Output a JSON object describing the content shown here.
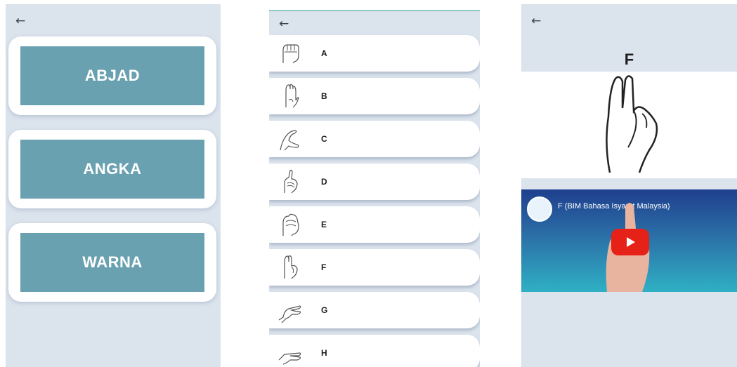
{
  "menu": {
    "items": [
      {
        "label": "ABJAD"
      },
      {
        "label": "ANGKA"
      },
      {
        "label": "WARNA"
      }
    ]
  },
  "alphabet": {
    "letters": [
      "A",
      "B",
      "C",
      "D",
      "E",
      "F",
      "G",
      "H"
    ]
  },
  "detail": {
    "letter": "F",
    "video_title": "F (BIM Bahasa Isyarat Malaysia)"
  },
  "icons": {
    "back": "arrow-left-icon",
    "play": "play-icon"
  },
  "colors": {
    "menu_button": "#6aa1b1",
    "background": "#dbe3ed",
    "play_button": "#e62117"
  }
}
